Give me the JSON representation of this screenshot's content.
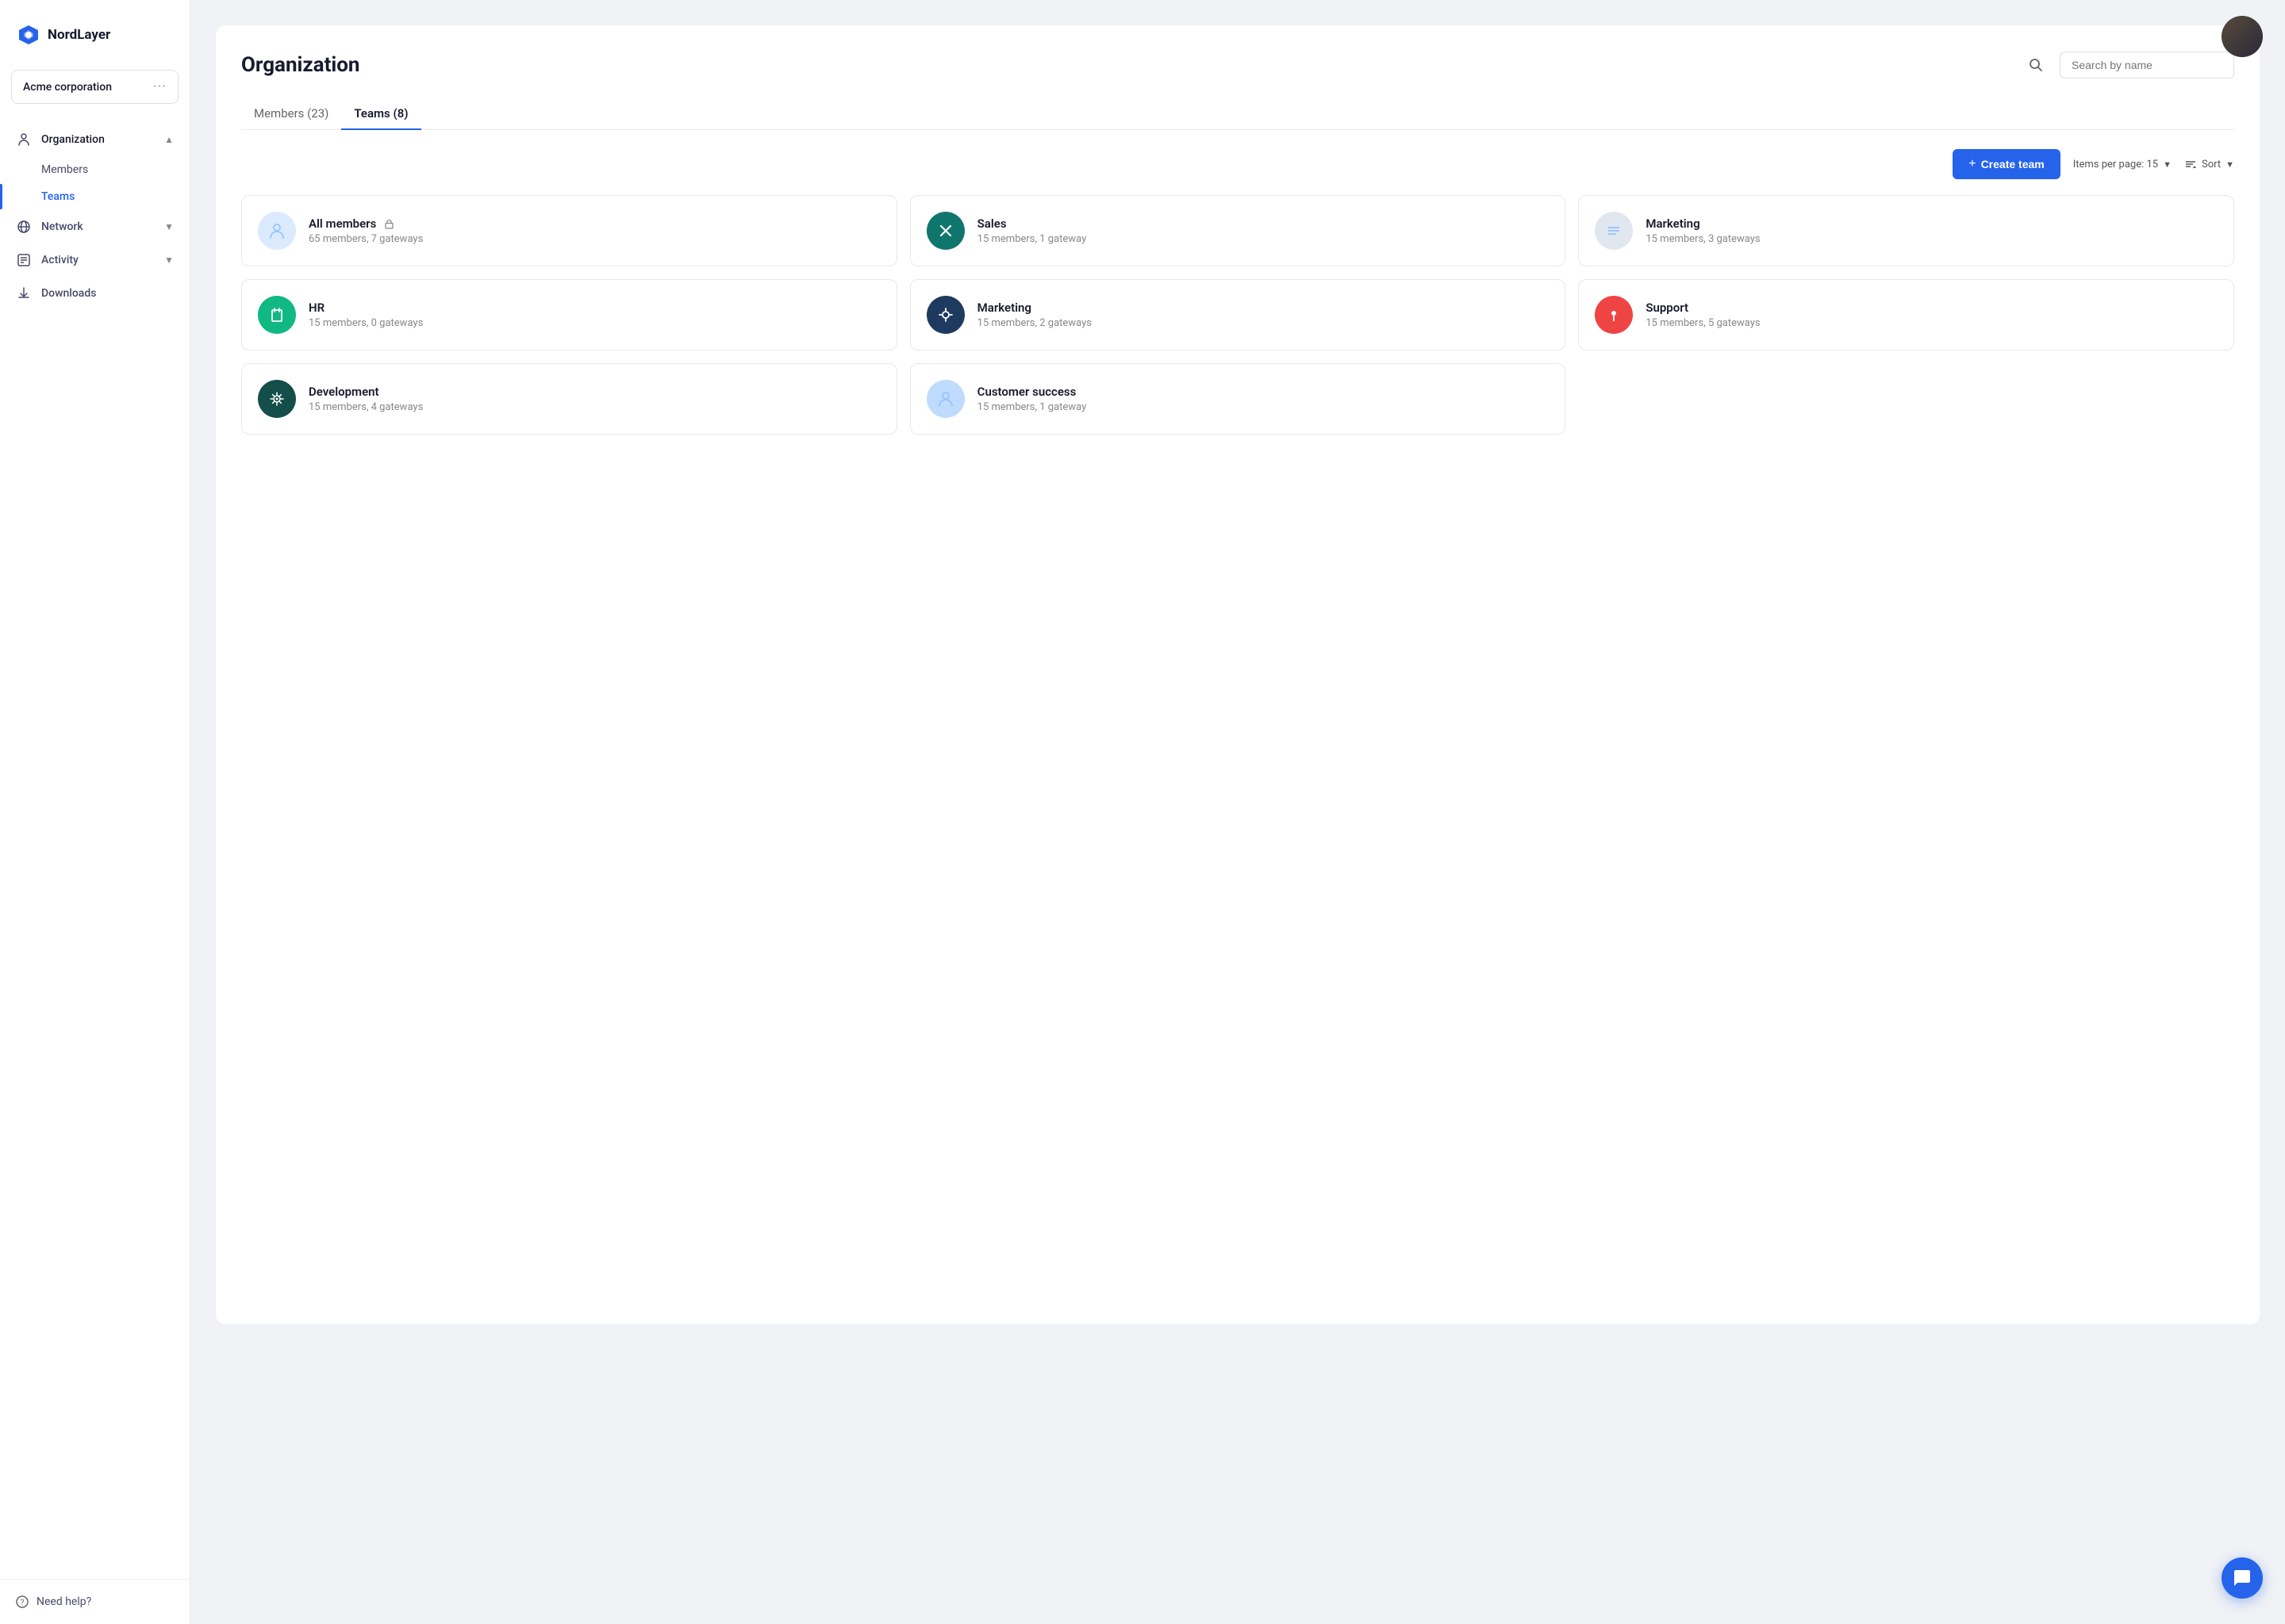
{
  "app": {
    "logo_text": "NordLayer"
  },
  "org_selector": {
    "name": "Acme corporation",
    "dots": "···"
  },
  "sidebar": {
    "items": [
      {
        "id": "organization",
        "label": "Organization",
        "icon": "org-icon",
        "expanded": true
      },
      {
        "id": "members",
        "label": "Members",
        "sub": true,
        "active": false
      },
      {
        "id": "teams",
        "label": "Teams",
        "sub": true,
        "active": true
      },
      {
        "id": "network",
        "label": "Network",
        "icon": "network-icon",
        "chevron": true
      },
      {
        "id": "activity",
        "label": "Activity",
        "icon": "activity-icon",
        "chevron": true
      },
      {
        "id": "downloads",
        "label": "Downloads",
        "icon": "downloads-icon"
      }
    ],
    "help_label": "Need help?"
  },
  "page": {
    "title": "Organization",
    "search_placeholder": "Search by name"
  },
  "tabs": [
    {
      "id": "members",
      "label": "Members",
      "count": 23,
      "active": false
    },
    {
      "id": "teams",
      "label": "Teams",
      "count": 8,
      "active": true
    }
  ],
  "toolbar": {
    "create_label": "Create team",
    "items_per_page_label": "Items per page:",
    "items_per_page_value": "15",
    "sort_label": "Sort"
  },
  "teams": [
    {
      "id": "all-members",
      "name": "All members",
      "lock": true,
      "meta": "65 members, 7 gateways",
      "icon_type": "icon-blue-light",
      "icon_char": "👤"
    },
    {
      "id": "sales",
      "name": "Sales",
      "lock": false,
      "meta": "15 members, 1 gateway",
      "icon_type": "icon-teal",
      "icon_char": "✕"
    },
    {
      "id": "marketing1",
      "name": "Marketing",
      "lock": false,
      "meta": "15 members, 3 gateways",
      "icon_type": "icon-blue-slate",
      "icon_char": "≡"
    },
    {
      "id": "hr",
      "name": "HR",
      "lock": false,
      "meta": "15 members, 0 gateways",
      "icon_type": "icon-green",
      "icon_char": "📁"
    },
    {
      "id": "marketing2",
      "name": "Marketing",
      "lock": false,
      "meta": "15 members, 2 gateways",
      "icon_type": "icon-dark-blue",
      "icon_char": "✚"
    },
    {
      "id": "support",
      "name": "Support",
      "lock": false,
      "meta": "15 members, 5 gateways",
      "icon_type": "icon-red",
      "icon_char": "!"
    },
    {
      "id": "development",
      "name": "Development",
      "lock": false,
      "meta": "15 members, 4 gateways",
      "icon_type": "icon-dark-teal",
      "icon_char": "⚙"
    },
    {
      "id": "customer-success",
      "name": "Customer success",
      "lock": false,
      "meta": "15 members, 1 gateway",
      "icon_type": "icon-blue-pale",
      "icon_char": "👤"
    }
  ]
}
